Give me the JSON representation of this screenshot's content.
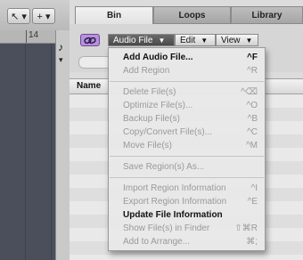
{
  "toolbar": {
    "pointer_tool": "↖ ▾",
    "pencil_tool": "+ ▾",
    "ruler_bar": "14",
    "note_icon": "♪",
    "down_arrow": "▾"
  },
  "tabs": [
    "Bin",
    "Loops",
    "Library"
  ],
  "bin_menus": {
    "audio_file": "Audio File",
    "edit": "Edit",
    "view": "View"
  },
  "table": {
    "name_header": "Name"
  },
  "menu": {
    "items": [
      {
        "label": "Add Audio File...",
        "shortcut": "^F",
        "enabled": true
      },
      {
        "label": "Add Region",
        "shortcut": "^R",
        "enabled": false
      },
      {
        "label": "Delete File(s)",
        "shortcut": "^⌫",
        "enabled": false
      },
      {
        "label": "Optimize File(s)...",
        "shortcut": "^O",
        "enabled": false
      },
      {
        "label": "Backup File(s)",
        "shortcut": "^B",
        "enabled": false
      },
      {
        "label": "Copy/Convert File(s)...",
        "shortcut": "^C",
        "enabled": false
      },
      {
        "label": "Move File(s)",
        "shortcut": "^M",
        "enabled": false
      },
      {
        "label": "Save Region(s) As...",
        "shortcut": "",
        "enabled": false
      },
      {
        "label": "Import Region Information",
        "shortcut": "^I",
        "enabled": false
      },
      {
        "label": "Export Region Information",
        "shortcut": "^E",
        "enabled": false
      },
      {
        "label": "Update File Information",
        "shortcut": "",
        "enabled": true
      },
      {
        "label": "Show File(s) in Finder",
        "shortcut": "⇧⌘R",
        "enabled": false
      },
      {
        "label": "Add to Arrange...",
        "shortcut": "⌘;",
        "enabled": false
      }
    ]
  },
  "colors": {
    "link_button": "#b790e0",
    "open_menu_button": "#555555"
  }
}
